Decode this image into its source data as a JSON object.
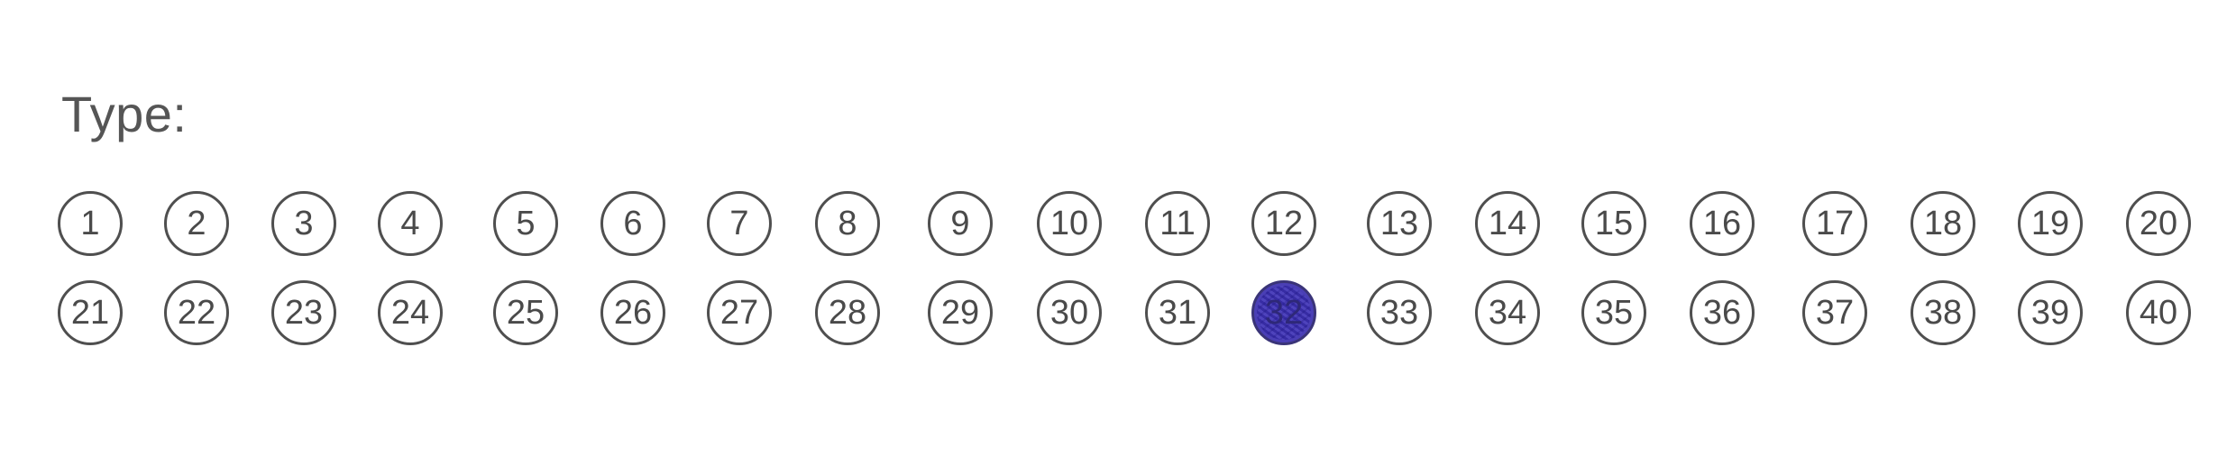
{
  "form": {
    "type_label": "Type:"
  },
  "bubbles": {
    "row1": [
      "1",
      "2",
      "3",
      "4",
      "5",
      "6",
      "7",
      "8",
      "9",
      "10",
      "11",
      "12",
      "13",
      "14",
      "15",
      "16",
      "17",
      "18",
      "19",
      "20"
    ],
    "row2": [
      "21",
      "22",
      "23",
      "24",
      "25",
      "26",
      "27",
      "28",
      "29",
      "30",
      "31",
      "32",
      "33",
      "34",
      "35",
      "36",
      "37",
      "38",
      "39",
      "40"
    ],
    "selected": "32",
    "fill_color": "#4a3fb5"
  }
}
